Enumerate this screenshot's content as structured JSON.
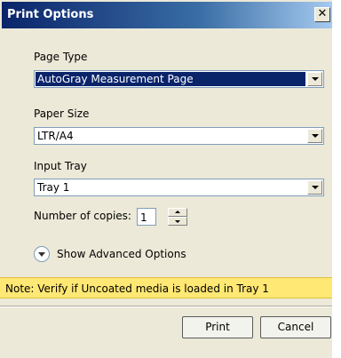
{
  "window": {
    "title": "Print Options",
    "close_glyph": "✕",
    "close_icon": "close-icon"
  },
  "page_type": {
    "label": "Page Type",
    "value": "AutoGray Measurement Page"
  },
  "paper_size": {
    "label": "Paper Size",
    "value": "LTR/A4"
  },
  "input_tray": {
    "label": "Input Tray",
    "value": "Tray 1"
  },
  "copies": {
    "label": "Number of copies:",
    "value": "1"
  },
  "advanced": {
    "label": "Show Advanced Options",
    "icon": "chevron-down-icon"
  },
  "note": {
    "text": "Note: Verify if Uncoated media is loaded in Tray 1",
    "color": "#ffe873"
  },
  "buttons": {
    "print": "Print",
    "cancel": "Cancel"
  },
  "colors": {
    "titlebar": "#0a246a",
    "dialog_bg": "#ece9d8",
    "selection": "#0a246a"
  }
}
